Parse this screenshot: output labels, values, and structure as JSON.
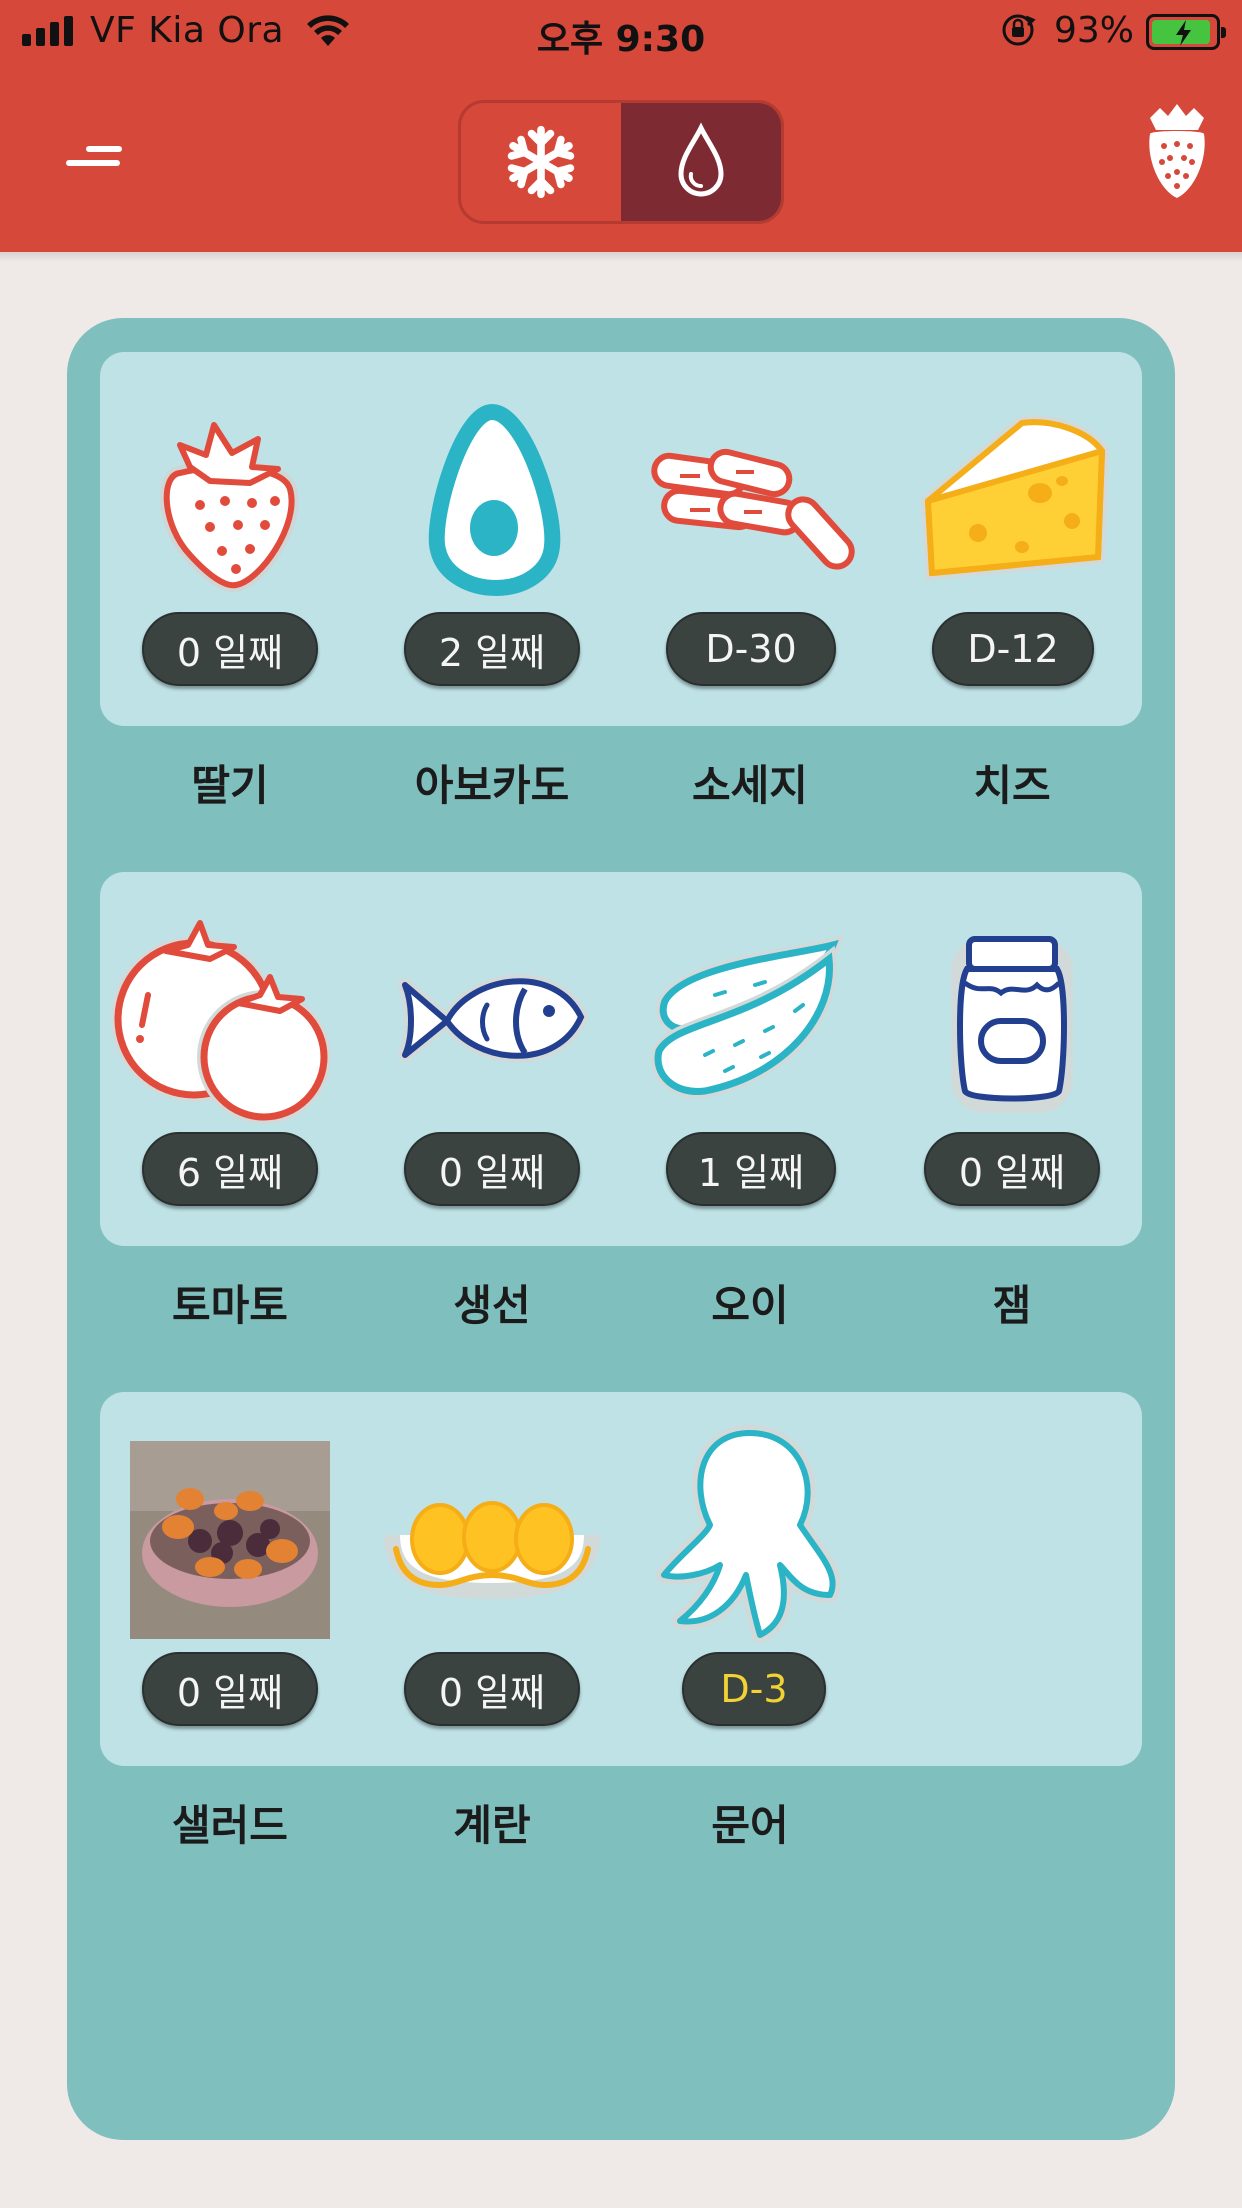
{
  "status_bar": {
    "carrier": "VF Kia Ora",
    "time": "오후 9:30",
    "battery_percent": "93%",
    "battery_level": 0.93
  },
  "header": {
    "modes": [
      {
        "name": "freezer",
        "icon": "snowflake-icon",
        "active": false
      },
      {
        "name": "fridge",
        "icon": "water-drop-icon",
        "active": true
      }
    ],
    "logo_icon": "strawberry-logo-icon"
  },
  "colors": {
    "header": "#d6483a",
    "segment_active": "#7d2a33",
    "panel": "#7fbfbe",
    "row": "#bfe2e6",
    "badge": "#3b4341",
    "badge_alert_text": "#f3d333"
  },
  "foods": [
    {
      "label": "딸기",
      "badge": "0 일째",
      "icon": "strawberry-icon"
    },
    {
      "label": "아보카도",
      "badge": "2 일째",
      "icon": "avocado-icon"
    },
    {
      "label": "소세지",
      "badge": "D-30",
      "icon": "sausage-icon"
    },
    {
      "label": "치즈",
      "badge": "D-12",
      "icon": "cheese-icon"
    },
    {
      "label": "토마토",
      "badge": "6 일째",
      "icon": "tomato-icon"
    },
    {
      "label": "생선",
      "badge": "0 일째",
      "icon": "fish-icon"
    },
    {
      "label": "오이",
      "badge": "1 일째",
      "icon": "cucumber-icon"
    },
    {
      "label": "잼",
      "badge": "0 일째",
      "icon": "jam-jar-icon"
    },
    {
      "label": "샐러드",
      "badge": "0 일째",
      "icon": "salad-photo"
    },
    {
      "label": "계란",
      "badge": "0 일째",
      "icon": "eggs-icon"
    },
    {
      "label": "문어",
      "badge": "D-3",
      "icon": "octopus-icon",
      "alert": true
    }
  ]
}
